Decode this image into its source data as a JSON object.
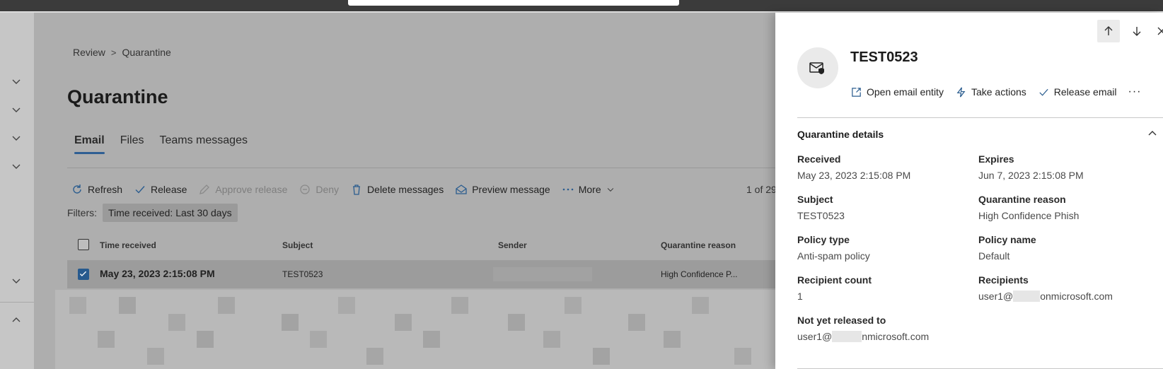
{
  "breadcrumb": {
    "items": [
      "Review",
      "Quarantine"
    ],
    "separator": ">"
  },
  "page": {
    "title": "Quarantine"
  },
  "tabs": [
    {
      "label": "Email",
      "active": true
    },
    {
      "label": "Files",
      "active": false
    },
    {
      "label": "Teams messages",
      "active": false
    }
  ],
  "toolbar": {
    "refresh": "Refresh",
    "release": "Release",
    "approve_release": "Approve release",
    "deny": "Deny",
    "delete_messages": "Delete messages",
    "preview_message": "Preview message",
    "more": "More",
    "pager": "1 of 29"
  },
  "filters": {
    "label": "Filters:",
    "pill_key": "Time received:",
    "pill_value": "Last 30 days"
  },
  "table": {
    "columns": [
      "Time received",
      "Subject",
      "Sender",
      "Quarantine reason"
    ],
    "rows": [
      {
        "time_received": "May 23, 2023 2:15:08 PM",
        "subject": "TEST0523",
        "quarantine_reason": "High Confidence P...",
        "selected": true
      }
    ]
  },
  "panel": {
    "title": "TEST0523",
    "actions": {
      "open_email_entity": "Open email entity",
      "take_actions": "Take actions",
      "release_email": "Release email",
      "more": "···"
    },
    "section_title": "Quarantine details",
    "fields": {
      "received": {
        "label": "Received",
        "value": "May 23, 2023 2:15:08 PM"
      },
      "expires": {
        "label": "Expires",
        "value": "Jun 7, 2023 2:15:08 PM"
      },
      "subject": {
        "label": "Subject",
        "value": "TEST0523"
      },
      "quarantine_reason": {
        "label": "Quarantine reason",
        "value": "High Confidence Phish"
      },
      "policy_type": {
        "label": "Policy type",
        "value": "Anti-spam policy"
      },
      "policy_name": {
        "label": "Policy name",
        "value": "Default"
      },
      "recipient_count": {
        "label": "Recipient count",
        "value": "1"
      },
      "recipients": {
        "label": "Recipients",
        "value_prefix": "user1@",
        "value_suffix": "onmicrosoft.com"
      },
      "not_yet_released": {
        "label": "Not yet released to",
        "value_prefix": "user1@",
        "value_suffix": "nmicrosoft.com"
      }
    }
  },
  "icons": {
    "nav_collapse": "chevron-down-icon",
    "nav_expand": "chevron-up-icon",
    "previous": "arrow-up-icon",
    "next": "arrow-down-icon",
    "close": "close-icon",
    "email_entity": "email-shield-icon"
  },
  "colors": {
    "accent": "#275a8e",
    "panel_bg": "#ffffff",
    "overlay": "#aeaeae"
  }
}
